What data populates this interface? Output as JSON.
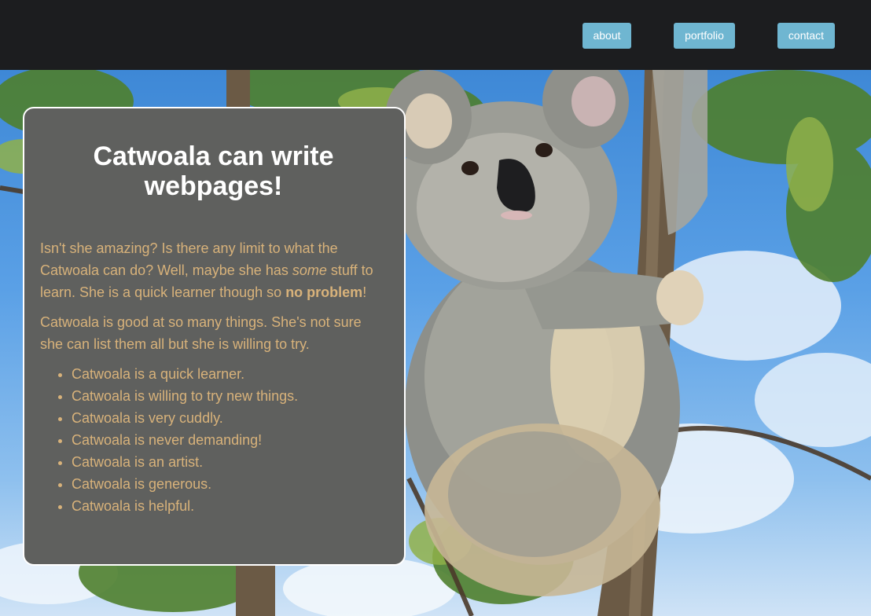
{
  "nav": {
    "items": [
      {
        "label": "about"
      },
      {
        "label": "portfolio"
      },
      {
        "label": "contact"
      }
    ]
  },
  "colors": {
    "topbar": "#1c1d1f",
    "nav_button": "#6fb6d1",
    "panel_bg": "#5f605e",
    "panel_text": "#d8b27a",
    "heading": "#ffffff"
  },
  "hero": {
    "image": "koala-on-tree-photo"
  },
  "panel": {
    "title": "Catwoala can write webpages!",
    "para1": {
      "t1": "Isn't she amazing? Is there any limit to what the Catwoala can do? Well, maybe she has ",
      "em": "some",
      "t2": " stuff to learn. She is a quick learner though so ",
      "strong": "no problem",
      "t3": "!"
    },
    "para2": "Catwoala is good at so many things. She's not sure she can list them all but she is willing to try.",
    "list": [
      "Catwoala is a quick learner.",
      "Catwoala is willing to try new things.",
      "Catwoala is very cuddly.",
      "Catwoala is never demanding!",
      "Catwoala is an artist.",
      "Catwoala is generous.",
      "Catwoala is helpful."
    ]
  }
}
